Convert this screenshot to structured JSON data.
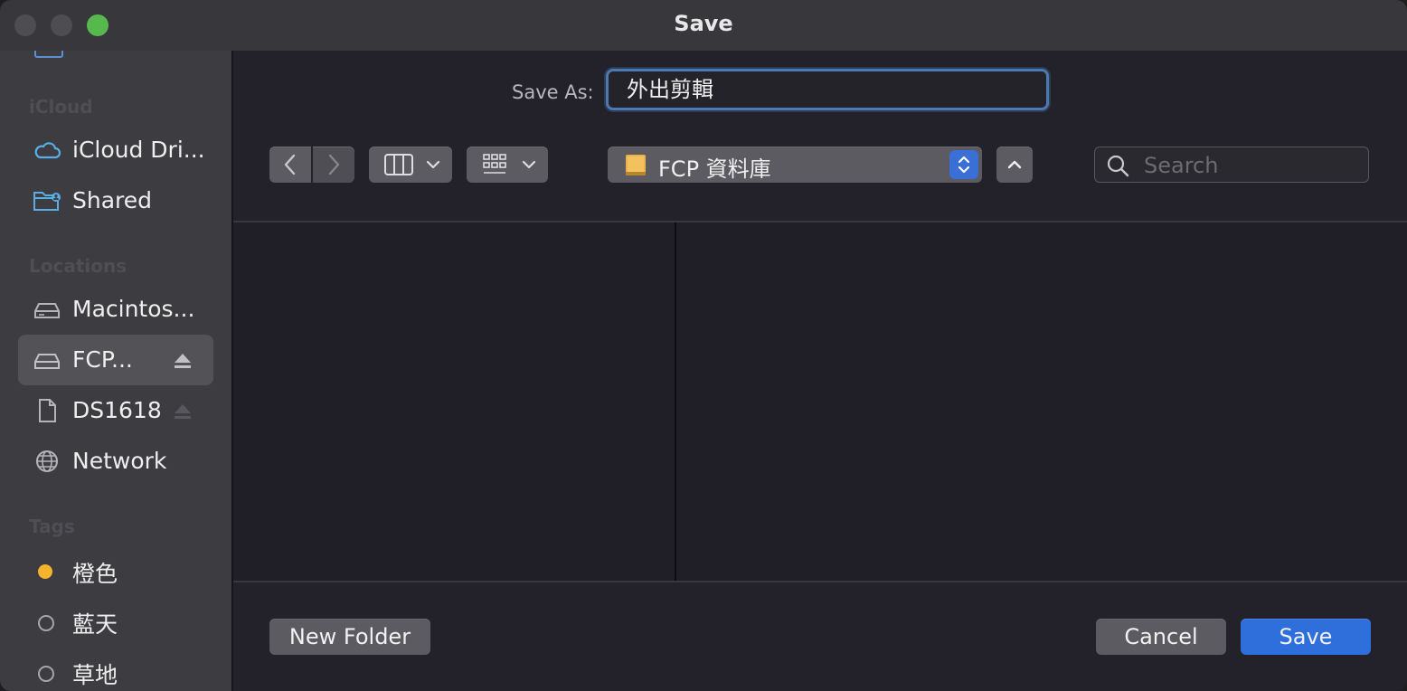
{
  "window": {
    "title": "Save"
  },
  "sidebar": {
    "sections": {
      "icloud": "iCloud",
      "locations": "Locations",
      "tags": "Tags"
    },
    "icloud_items": [
      {
        "label": "iCloud Dri...",
        "icon": "cloud-icon"
      },
      {
        "label": "Shared",
        "icon": "shared-folder-icon"
      }
    ],
    "location_items": [
      {
        "label": "Macintos...",
        "icon": "internal-drive-icon"
      },
      {
        "label": "FCP...",
        "icon": "external-drive-icon",
        "selected": true,
        "eject": true
      },
      {
        "label": "DS1618",
        "icon": "document-icon",
        "eject": true
      },
      {
        "label": "Network",
        "icon": "globe-icon"
      }
    ],
    "tag_items": [
      {
        "label": "橙色",
        "color": "#f6b32c"
      },
      {
        "label": "藍天",
        "color": ""
      },
      {
        "label": "草地",
        "color": ""
      }
    ]
  },
  "save_as": {
    "label": "Save As:",
    "value": "外出剪輯"
  },
  "toolbar": {
    "location": "FCP 資料庫",
    "search_placeholder": "Search"
  },
  "footer": {
    "new_folder": "New Folder",
    "cancel": "Cancel",
    "save": "Save"
  },
  "colors": {
    "accent": "#2f6fdc",
    "tag_orange": "#f6b32c",
    "traffic_green": "#57b84e"
  }
}
